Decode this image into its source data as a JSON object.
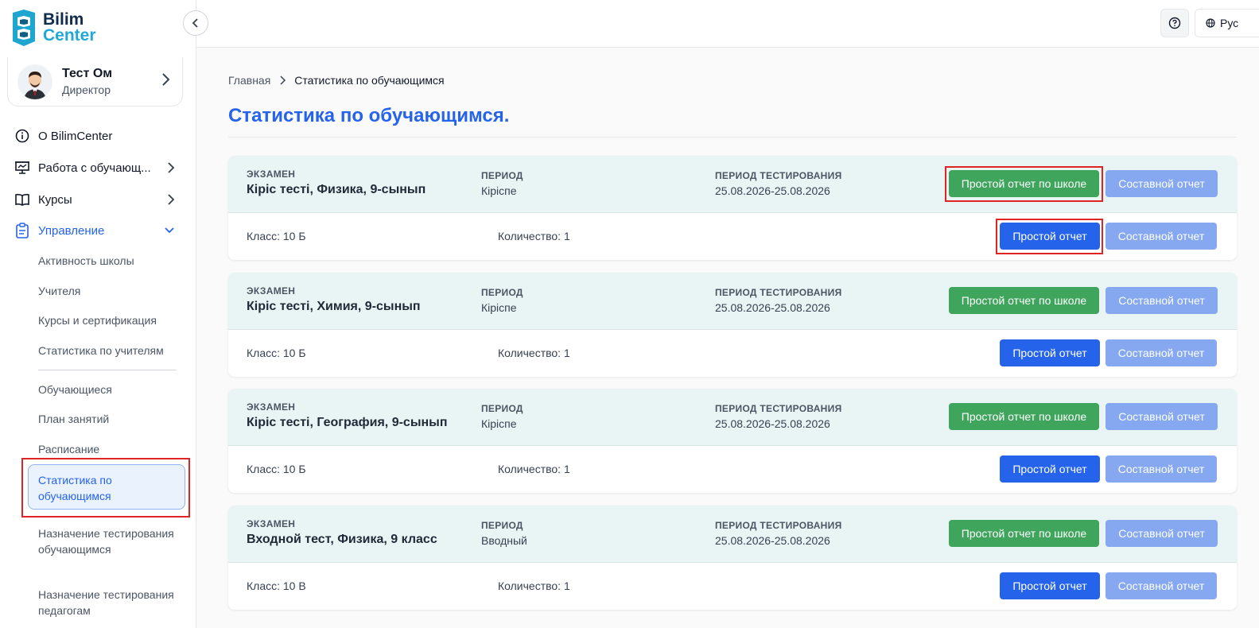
{
  "logo": {
    "line1": "Bilim",
    "line2": "Center"
  },
  "profile": {
    "name": "Тест Ом",
    "role": "Директор"
  },
  "nav": {
    "about": "О BilimCenter",
    "students_work": "Работа с обучающ...",
    "courses": "Курсы",
    "management": "Управление"
  },
  "submenu": [
    "Активность школы",
    "Учителя",
    "Курсы и сертификация",
    "Статистика по учителям",
    "Обучающиеся",
    "План занятий",
    "Расписание",
    "Статистика по обучающимся",
    "Назначение тестирования обучающимся",
    "Назначение тестирования педагогам"
  ],
  "topbar": {
    "lang": "Рус"
  },
  "breadcrumb": {
    "home": "Главная",
    "current": "Статистика по обучающимся"
  },
  "page_title": "Статистика по обучающимся.",
  "labels": {
    "exam": "ЭКЗАМЕН",
    "period": "ПЕРИОД",
    "test_period": "ПЕРИОД ТЕСТИРОВАНИЯ",
    "btn_school_report": "Простой отчет по школе",
    "btn_composite": "Составной отчет",
    "btn_simple": "Простой отчет"
  },
  "cards": [
    {
      "exam": "Кіріс тесті, Физика, 9-сынып",
      "period": "Кіріспе",
      "test_period": "25.08.2026-25.08.2026",
      "class": "Класс: 10 Б",
      "count": "Количество: 1"
    },
    {
      "exam": "Кіріс тесті, Химия, 9-сынып",
      "period": "Кіріспе",
      "test_period": "25.08.2026-25.08.2026",
      "class": "Класс: 10 Б",
      "count": "Количество: 1"
    },
    {
      "exam": "Кіріс тесті, География, 9-сынып",
      "period": "Кіріспе",
      "test_period": "25.08.2026-25.08.2026",
      "class": "Класс: 10 Б",
      "count": "Количество: 1"
    },
    {
      "exam": "Входной тест, Физика, 9 класс",
      "period": "Вводный",
      "test_period": "25.08.2026-25.08.2026",
      "class": "Класс: 10 В",
      "count": "Количество: 1"
    }
  ],
  "colors": {
    "accent": "#2563eb",
    "green": "#3fa45c",
    "highlight": "#e02424"
  }
}
